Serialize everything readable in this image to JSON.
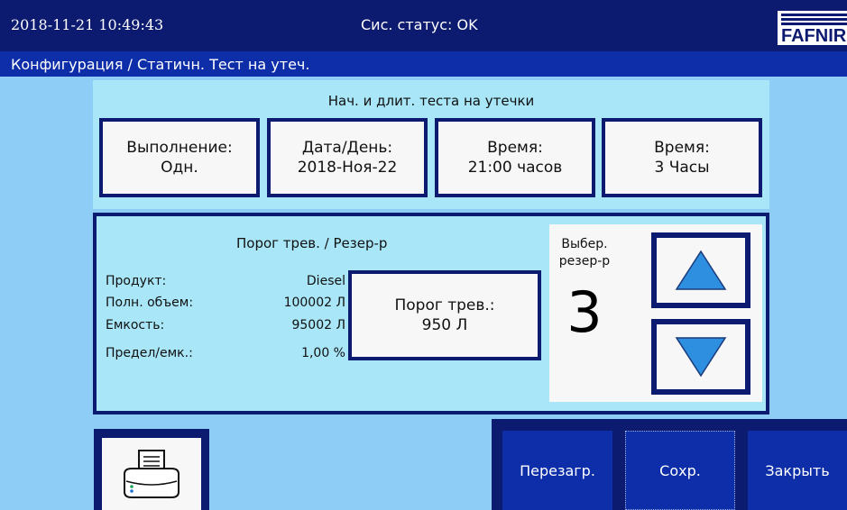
{
  "header": {
    "datetime": "2018-11-21  10:49:43",
    "status": "Сис. статус: OK",
    "logo_text": "FAFNIR"
  },
  "breadcrumb": "Конфигурация / Статичн. Тест на утеч.",
  "leak_test": {
    "title": "Нач. и длит. теста на утечки",
    "boxes": [
      {
        "label": "Выполнение:",
        "value": "Одн."
      },
      {
        "label": "Дата/День:",
        "value": "2018-Ноя-22"
      },
      {
        "label": "Время:",
        "value": "21:00 часов"
      },
      {
        "label": "Время:",
        "value": "3 Часы"
      }
    ]
  },
  "tank": {
    "title": "Порог трев. / Резер-р",
    "rows": [
      {
        "label": "Продукт:",
        "value": "Diesel"
      },
      {
        "label": "Полн. объем:",
        "value": "100002 Л"
      },
      {
        "label": "Емкость:",
        "value": "95002 Л"
      },
      {
        "label": "Предел/емк.:",
        "value": "1,00 %"
      }
    ],
    "alarm_label": "Порог трев.:",
    "alarm_value": "950 Л",
    "select_label_1": "Выбер.",
    "select_label_2": "резер-р",
    "selected_tank": "3"
  },
  "buttons": {
    "reload": "Перезагр.",
    "save": "Сохр.",
    "close": "Закрыть"
  },
  "icons": [
    "up-arrow-icon",
    "down-arrow-icon",
    "printer-icon"
  ],
  "colors": {
    "background": "#8ecdf5",
    "header": "#0c1a70",
    "breadcrumb": "#0d2ea8",
    "panel": "#a8e6f8",
    "arrow": "#2e8fe0"
  }
}
